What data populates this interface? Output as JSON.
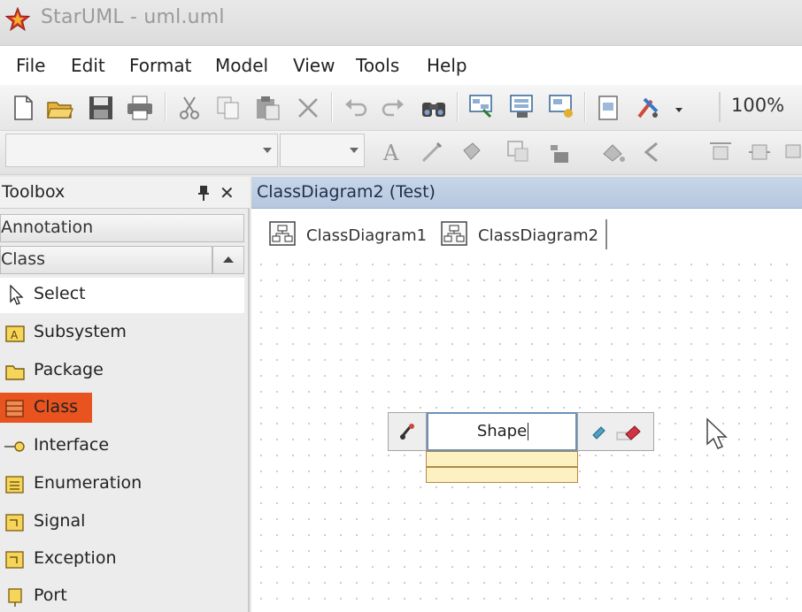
{
  "window": {
    "title": "StarUML - uml.uml"
  },
  "menu": [
    "File",
    "Edit",
    "Format",
    "Model",
    "View",
    "Tools",
    "Help"
  ],
  "toolbar": {
    "zoom": "100%",
    "icons": [
      "new-icon",
      "open-icon",
      "save-icon",
      "print-icon",
      "cut-icon",
      "copy-icon",
      "paste-icon",
      "delete-icon",
      "undo-icon",
      "redo-icon",
      "find-icon",
      "diagram-icon-1",
      "diagram-icon-2",
      "diagram-icon-3",
      "export-icon",
      "tools-icon"
    ]
  },
  "toolbox": {
    "title": "Toolbox",
    "sections": {
      "annotation": "Annotation",
      "class": "Class"
    },
    "items": [
      {
        "label": "Select",
        "icon": "pointer-icon"
      },
      {
        "label": "Subsystem",
        "icon": "subsystem-icon"
      },
      {
        "label": "Package",
        "icon": "package-icon"
      },
      {
        "label": "Class",
        "icon": "class-icon"
      },
      {
        "label": "Interface",
        "icon": "interface-icon"
      },
      {
        "label": "Enumeration",
        "icon": "enumeration-icon"
      },
      {
        "label": "Signal",
        "icon": "signal-icon"
      },
      {
        "label": "Exception",
        "icon": "exception-icon"
      },
      {
        "label": "Port",
        "icon": "port-icon"
      }
    ],
    "selected_item": "Select",
    "active_item": "Class",
    "active_color": "#e8531f"
  },
  "diagram": {
    "title": "ClassDiagram2 (Test)",
    "tabs": [
      "ClassDiagram1",
      "ClassDiagram2"
    ],
    "class_shape": {
      "name": "Shape"
    }
  },
  "colors": {
    "header": "#bacbe0",
    "class_fill": "#fdf1c1",
    "class_border": "#b08a47"
  }
}
